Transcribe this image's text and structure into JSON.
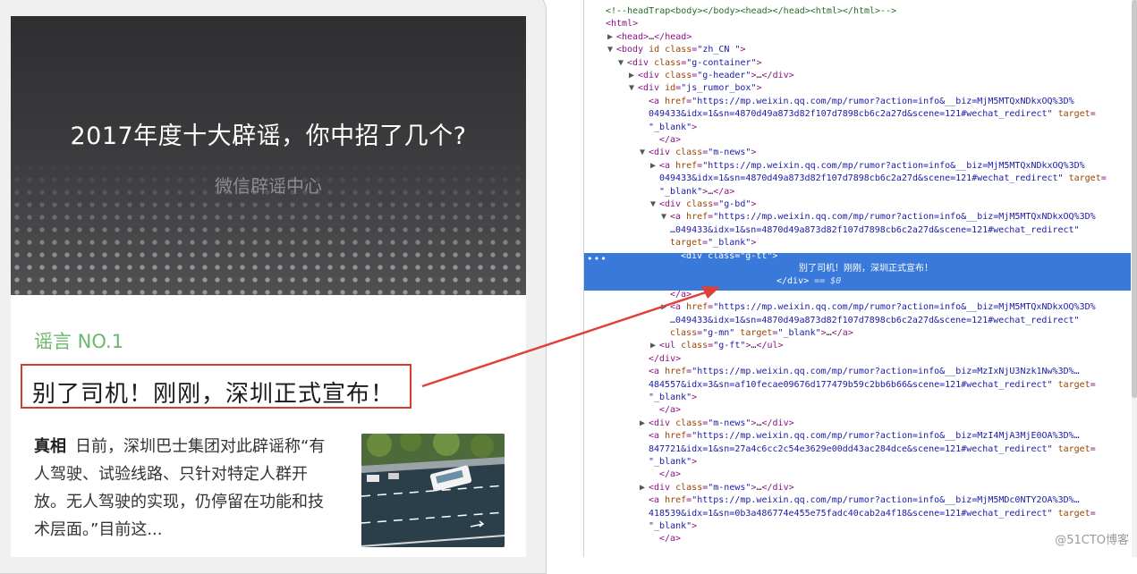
{
  "article": {
    "hero_title": "2017年度十大辟谣，你中招了几个?",
    "hero_source": "微信辟谣中心",
    "rumor_tag": "谣言 NO.1",
    "rumor_title": "别了司机！刚刚，深圳正式宣布！",
    "truth_label": "真相",
    "truth_text": "日前，深圳巴士集团对此辟谣称“有人驾驶、试验线路、只针对特定人群开放。无人驾驶的实现，仍停留在功能和技术层面。”目前这...",
    "thumbnail_alt": "road-aerial-photo"
  },
  "devtools": {
    "lines": [
      {
        "indent": 0,
        "tri": "",
        "parts": [
          [
            "comment",
            "<!--headTrap<body></body><head></head><html></html>-->"
          ]
        ]
      },
      {
        "indent": 0,
        "tri": "",
        "parts": [
          [
            "tag",
            "<html>"
          ]
        ]
      },
      {
        "indent": 1,
        "tri": "▶",
        "parts": [
          [
            "tag",
            "<head>"
          ],
          [
            "plain",
            "…"
          ],
          [
            "tag",
            "</head>"
          ]
        ]
      },
      {
        "indent": 1,
        "tri": "▼",
        "parts": [
          [
            "tag",
            "<body "
          ],
          [
            "attr-name",
            "id class"
          ],
          [
            "tag",
            "="
          ],
          [
            "attr-val",
            "\"zh_CN \""
          ],
          [
            "tag",
            ">"
          ]
        ]
      },
      {
        "indent": 2,
        "tri": "▼",
        "parts": [
          [
            "tag",
            "<div "
          ],
          [
            "attr-name",
            "class"
          ],
          [
            "tag",
            "="
          ],
          [
            "attr-val",
            "\"g-container\""
          ],
          [
            "tag",
            ">"
          ]
        ]
      },
      {
        "indent": 3,
        "tri": "▶",
        "parts": [
          [
            "tag",
            "<div "
          ],
          [
            "attr-name",
            "class"
          ],
          [
            "tag",
            "="
          ],
          [
            "attr-val",
            "\"g-header\""
          ],
          [
            "tag",
            ">"
          ],
          [
            "plain",
            "…"
          ],
          [
            "tag",
            "</div>"
          ]
        ]
      },
      {
        "indent": 3,
        "tri": "▼",
        "parts": [
          [
            "tag",
            "<div "
          ],
          [
            "attr-name",
            "id"
          ],
          [
            "tag",
            "="
          ],
          [
            "attr-val",
            "\"js_rumor_box\""
          ],
          [
            "tag",
            ">"
          ]
        ]
      },
      {
        "indent": 4,
        "tri": "",
        "parts": [
          [
            "tag",
            "<a "
          ],
          [
            "attr-name",
            "href"
          ],
          [
            "tag",
            "="
          ],
          [
            "attr-val",
            "\"https://mp.weixin.qq.com/mp/rumor?action=info&__biz=MjM5MTQxNDkxOQ%3D%"
          ]
        ]
      },
      {
        "indent": 4,
        "tri": "",
        "parts": [
          [
            "attr-val",
            "049433&idx=1&sn=4870d49a873d82f107d7898cb6c2a27d&scene=121#wechat_redirect\" "
          ],
          [
            "attr-name",
            "target"
          ],
          [
            "tag",
            "="
          ]
        ]
      },
      {
        "indent": 4,
        "tri": "",
        "parts": [
          [
            "attr-val",
            "\"_blank\""
          ],
          [
            "tag",
            ">"
          ]
        ]
      },
      {
        "indent": 5,
        "tri": "",
        "parts": [
          [
            "tag",
            "</a>"
          ]
        ]
      },
      {
        "indent": 4,
        "tri": "▼",
        "parts": [
          [
            "tag",
            "<div "
          ],
          [
            "attr-name",
            "class"
          ],
          [
            "tag",
            "="
          ],
          [
            "attr-val",
            "\"m-news\""
          ],
          [
            "tag",
            ">"
          ]
        ]
      },
      {
        "indent": 5,
        "tri": "▶",
        "parts": [
          [
            "tag",
            "<a "
          ],
          [
            "attr-name",
            "href"
          ],
          [
            "tag",
            "="
          ],
          [
            "attr-val",
            "\"https://mp.weixin.qq.com/mp/rumor?action=info&__biz=MjM5MTQxNDkxOQ%3D%"
          ]
        ]
      },
      {
        "indent": 5,
        "tri": "",
        "parts": [
          [
            "attr-val",
            "049433&idx=1&sn=4870d49a873d82f107d7898cb6c2a27d&scene=121#wechat_redirect\" "
          ],
          [
            "attr-name",
            "target"
          ],
          [
            "tag",
            "="
          ]
        ]
      },
      {
        "indent": 5,
        "tri": "",
        "parts": [
          [
            "attr-val",
            "\"_blank\""
          ],
          [
            "tag",
            ">"
          ],
          [
            "plain",
            "…"
          ],
          [
            "tag",
            "</a>"
          ]
        ]
      },
      {
        "indent": 5,
        "tri": "▼",
        "parts": [
          [
            "tag",
            "<div "
          ],
          [
            "attr-name",
            "class"
          ],
          [
            "tag",
            "="
          ],
          [
            "attr-val",
            "\"g-bd\""
          ],
          [
            "tag",
            ">"
          ]
        ]
      },
      {
        "indent": 6,
        "tri": "▼",
        "parts": [
          [
            "tag",
            "<a "
          ],
          [
            "attr-name",
            "href"
          ],
          [
            "tag",
            "="
          ],
          [
            "attr-val",
            "\"https://mp.weixin.qq.com/mp/rumor?action=info&__biz=MjM5MTQxNDkxOQ%3D%"
          ]
        ]
      },
      {
        "indent": 6,
        "tri": "",
        "parts": [
          [
            "attr-val",
            "…049433&idx=1&sn=4870d49a873d82f107d7898cb6c2a27d&scene=121#wechat_redirect\""
          ]
        ]
      },
      {
        "indent": 6,
        "tri": "",
        "parts": [
          [
            "attr-name",
            "target"
          ],
          [
            "tag",
            "="
          ],
          [
            "attr-val",
            "\"_blank\""
          ],
          [
            "tag",
            ">"
          ]
        ]
      },
      {
        "indent": 7,
        "tri": "",
        "sel": true,
        "parts": [
          [
            "sel-text",
            "<div class=\"g-tt\">"
          ]
        ]
      },
      {
        "indent": 8,
        "tri": "",
        "sel": true,
        "parts": [
          [
            "sel-text",
            "别了司机！刚刚，深圳正式宣布！"
          ]
        ]
      },
      {
        "indent": 7,
        "tri": "",
        "sel": true,
        "parts": [
          [
            "sel-text",
            "</div>"
          ],
          [
            "sel-eq",
            " == $0"
          ]
        ]
      },
      {
        "indent": 6,
        "tri": "",
        "parts": [
          [
            "tag",
            "</a>"
          ]
        ]
      },
      {
        "indent": 6,
        "tri": "▶",
        "parts": [
          [
            "tag",
            "<a "
          ],
          [
            "attr-name",
            "href"
          ],
          [
            "tag",
            "="
          ],
          [
            "attr-val",
            "\"https://mp.weixin.qq.com/mp/rumor?action=info&__biz=MjM5MTQxNDkxOQ%3D%"
          ]
        ]
      },
      {
        "indent": 6,
        "tri": "",
        "parts": [
          [
            "attr-val",
            "…049433&idx=1&sn=4870d49a873d82f107d7898cb6c2a27d&scene=121#wechat_redirect\""
          ]
        ]
      },
      {
        "indent": 6,
        "tri": "",
        "parts": [
          [
            "attr-name",
            "class"
          ],
          [
            "tag",
            "="
          ],
          [
            "attr-val",
            "\"g-mn\" "
          ],
          [
            "attr-name",
            "target"
          ],
          [
            "tag",
            "="
          ],
          [
            "attr-val",
            "\"_blank\""
          ],
          [
            "tag",
            ">"
          ],
          [
            "plain",
            "…"
          ],
          [
            "tag",
            "</a>"
          ]
        ]
      },
      {
        "indent": 5,
        "tri": "▶",
        "parts": [
          [
            "tag",
            "<ul "
          ],
          [
            "attr-name",
            "class"
          ],
          [
            "tag",
            "="
          ],
          [
            "attr-val",
            "\"g-ft\""
          ],
          [
            "tag",
            ">"
          ],
          [
            "plain",
            "…"
          ],
          [
            "tag",
            "</ul>"
          ]
        ]
      },
      {
        "indent": 4,
        "tri": "",
        "parts": [
          [
            "tag",
            "</div>"
          ]
        ]
      },
      {
        "indent": 4,
        "tri": "",
        "parts": [
          [
            "tag",
            "<a "
          ],
          [
            "attr-name",
            "href"
          ],
          [
            "tag",
            "="
          ],
          [
            "attr-val",
            "\"https://mp.weixin.qq.com/mp/rumor?action=info&__biz=MzIxNjU3Nzk1Nw%3D%…"
          ]
        ]
      },
      {
        "indent": 4,
        "tri": "",
        "parts": [
          [
            "attr-val",
            "484557&idx=3&sn=af10fecae09676d177479b59c2bb6b66&scene=121#wechat_redirect\" "
          ],
          [
            "attr-name",
            "target"
          ],
          [
            "tag",
            "="
          ]
        ]
      },
      {
        "indent": 4,
        "tri": "",
        "parts": [
          [
            "attr-val",
            "\"_blank\""
          ],
          [
            "tag",
            ">"
          ]
        ]
      },
      {
        "indent": 5,
        "tri": "",
        "parts": [
          [
            "tag",
            "</a>"
          ]
        ]
      },
      {
        "indent": 4,
        "tri": "▶",
        "parts": [
          [
            "tag",
            "<div "
          ],
          [
            "attr-name",
            "class"
          ],
          [
            "tag",
            "="
          ],
          [
            "attr-val",
            "\"m-news\""
          ],
          [
            "tag",
            ">"
          ],
          [
            "plain",
            "…"
          ],
          [
            "tag",
            "</div>"
          ]
        ]
      },
      {
        "indent": 4,
        "tri": "",
        "parts": [
          [
            "tag",
            "<a "
          ],
          [
            "attr-name",
            "href"
          ],
          [
            "tag",
            "="
          ],
          [
            "attr-val",
            "\"https://mp.weixin.qq.com/mp/rumor?action=info&__biz=MzI4MjA3MjE0OA%3D%…"
          ]
        ]
      },
      {
        "indent": 4,
        "tri": "",
        "parts": [
          [
            "attr-val",
            "847721&idx=1&sn=27a4c6cc2c54e3629e00dd43ac284dce&scene=121#wechat_redirect\" "
          ],
          [
            "attr-name",
            "target"
          ],
          [
            "tag",
            "="
          ]
        ]
      },
      {
        "indent": 4,
        "tri": "",
        "parts": [
          [
            "attr-val",
            "\"_blank\""
          ],
          [
            "tag",
            ">"
          ]
        ]
      },
      {
        "indent": 5,
        "tri": "",
        "parts": [
          [
            "tag",
            "</a>"
          ]
        ]
      },
      {
        "indent": 4,
        "tri": "▶",
        "parts": [
          [
            "tag",
            "<div "
          ],
          [
            "attr-name",
            "class"
          ],
          [
            "tag",
            "="
          ],
          [
            "attr-val",
            "\"m-news\""
          ],
          [
            "tag",
            ">"
          ],
          [
            "plain",
            "…"
          ],
          [
            "tag",
            "</div>"
          ]
        ]
      },
      {
        "indent": 4,
        "tri": "",
        "parts": [
          [
            "tag",
            "<a "
          ],
          [
            "attr-name",
            "href"
          ],
          [
            "tag",
            "="
          ],
          [
            "attr-val",
            "\"https://mp.weixin.qq.com/mp/rumor?action=info&__biz=MjM5MDc0NTY2OA%3D%…"
          ]
        ]
      },
      {
        "indent": 4,
        "tri": "",
        "parts": [
          [
            "attr-val",
            "418539&idx=1&sn=0b3a486774e455e75fadc40cab2a4f18&scene=121#wechat_redirect\" "
          ],
          [
            "attr-name",
            "target"
          ],
          [
            "tag",
            "="
          ]
        ]
      },
      {
        "indent": 4,
        "tri": "",
        "parts": [
          [
            "attr-val",
            "\"_blank\""
          ],
          [
            "tag",
            ">"
          ]
        ]
      },
      {
        "indent": 5,
        "tri": "",
        "parts": [
          [
            "tag",
            "</a>"
          ]
        ]
      }
    ],
    "gutter_dots": "•••"
  },
  "watermark": "@51CTO博客",
  "colors": {
    "highlight_box": "#d83a2f",
    "arrow": "#e0403a",
    "selection": "#3879d9",
    "rumor_tag": "#6bb86b"
  }
}
